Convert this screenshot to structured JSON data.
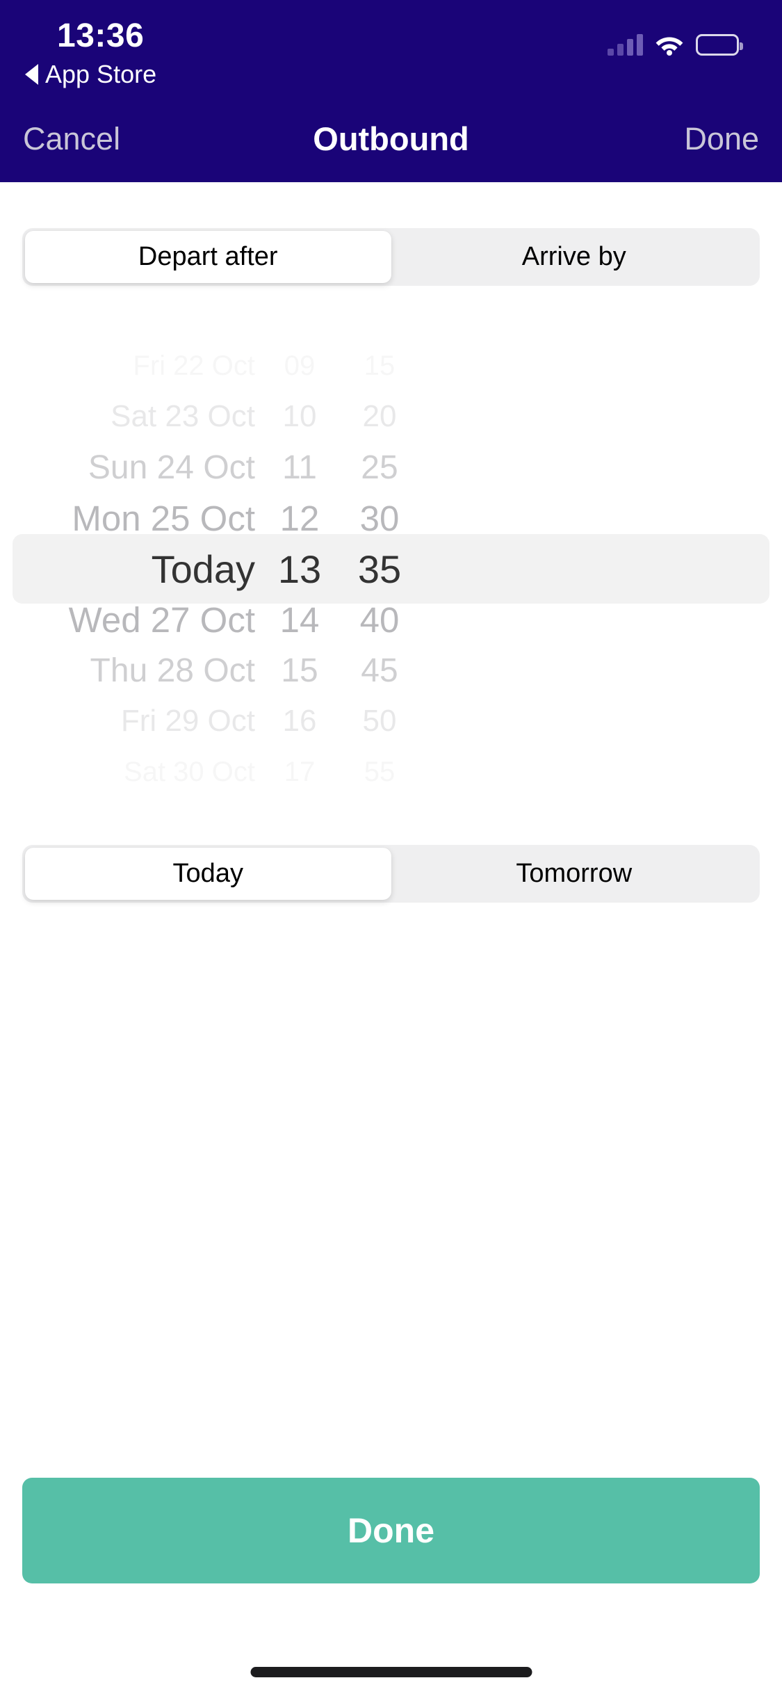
{
  "status_bar": {
    "time": "13:36",
    "back_label": "App Store",
    "back_arrow_icon": "triangle-left-icon",
    "signal_icon": "cellular-signal-icon",
    "wifi_icon": "wifi-icon",
    "battery_icon": "battery-full-icon"
  },
  "navbar": {
    "cancel_label": "Cancel",
    "title": "Outbound",
    "done_label": "Done"
  },
  "mode_segment": {
    "options": [
      "Depart after",
      "Arrive by"
    ],
    "selected_index": 0
  },
  "day_segment": {
    "options": [
      "Today",
      "Tomorrow"
    ],
    "selected_index": 0
  },
  "picker": {
    "selected": {
      "date": "Today",
      "hour": "13",
      "minute": "35"
    },
    "rows": [
      {
        "date": "Fri 22 Oct",
        "hour": "09",
        "minute": "15",
        "opacity": 0.07,
        "size": 40,
        "selected": false
      },
      {
        "date": "Sat 23 Oct",
        "hour": "10",
        "minute": "20",
        "opacity": 0.2,
        "size": 44,
        "selected": false
      },
      {
        "date": "Sun 24 Oct",
        "hour": "11",
        "minute": "25",
        "opacity": 0.42,
        "size": 48,
        "selected": false
      },
      {
        "date": "Mon 25 Oct",
        "hour": "12",
        "minute": "30",
        "opacity": 0.62,
        "size": 51,
        "selected": false
      },
      {
        "date": "Today",
        "hour": "13",
        "minute": "35",
        "opacity": 1.0,
        "size": 56,
        "selected": true
      },
      {
        "date": "Wed 27 Oct",
        "hour": "14",
        "minute": "40",
        "opacity": 0.62,
        "size": 51,
        "selected": false
      },
      {
        "date": "Thu 28 Oct",
        "hour": "15",
        "minute": "45",
        "opacity": 0.42,
        "size": 48,
        "selected": false
      },
      {
        "date": "Fri 29 Oct",
        "hour": "16",
        "minute": "50",
        "opacity": 0.2,
        "size": 44,
        "selected": false
      },
      {
        "date": "Sat 30 Oct",
        "hour": "17",
        "minute": "55",
        "opacity": 0.07,
        "size": 40,
        "selected": false
      }
    ]
  },
  "primary_button": {
    "label": "Done"
  },
  "colors": {
    "navy": "#1a0478",
    "green": "#56bfa7",
    "segment_track": "#efeff0",
    "picker_highlight": "#f2f2f2",
    "muted_text": "#8e8e93",
    "selected_text": "#333333"
  }
}
